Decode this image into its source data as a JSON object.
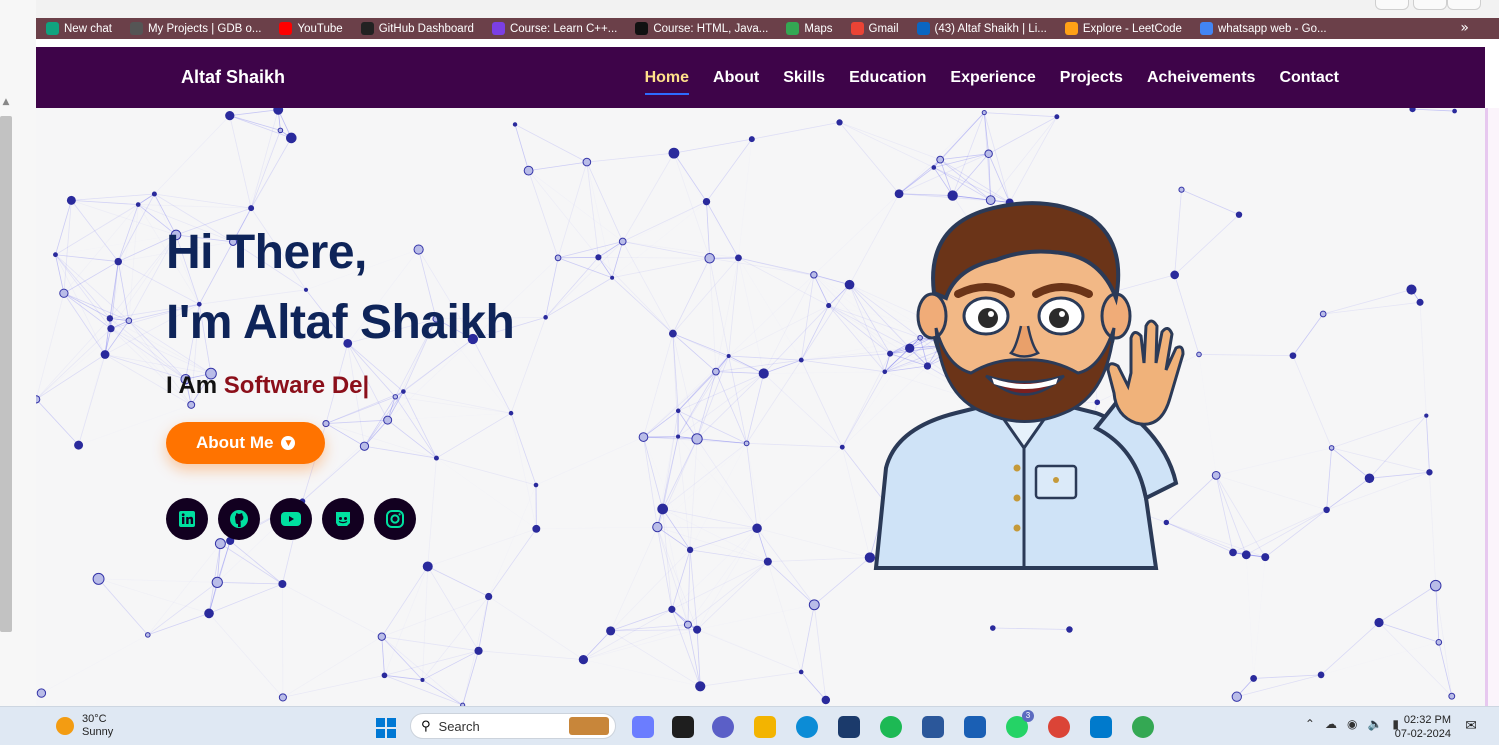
{
  "bookmarks": [
    {
      "label": "New chat",
      "color": "#10a37f"
    },
    {
      "label": "My Projects | GDB o...",
      "color": "#555555"
    },
    {
      "label": "YouTube",
      "color": "#ff0000"
    },
    {
      "label": "GitHub Dashboard",
      "color": "#222222"
    },
    {
      "label": "Course: Learn C++...",
      "color": "#7b3fe4"
    },
    {
      "label": "Course: HTML, Java...",
      "color": "#111111"
    },
    {
      "label": "Maps",
      "color": "#34a853"
    },
    {
      "label": "Gmail",
      "color": "#ea4335"
    },
    {
      "label": "(43) Altaf Shaikh | Li...",
      "color": "#0a66c2"
    },
    {
      "label": "Explore - LeetCode",
      "color": "#ffa116"
    },
    {
      "label": "whatsapp web - Go...",
      "color": "#4285f4"
    }
  ],
  "bookmarks_more": "»",
  "nav": {
    "brand": "Altaf Shaikh",
    "links": [
      "Home",
      "About",
      "Skills",
      "Education",
      "Experience",
      "Projects",
      "Acheivements",
      "Contact"
    ],
    "active_index": 0
  },
  "hero": {
    "greeting_line1": "Hi There,",
    "greeting_line2": "I'm Altaf Shaikh",
    "typing_prefix": "I Am ",
    "typing_role": "Software De|",
    "about_button": "About Me",
    "socials": [
      "linkedin-icon",
      "github-icon",
      "youtube-icon",
      "discord-icon",
      "instagram-icon"
    ]
  },
  "taskbar": {
    "temperature": "30°C",
    "condition": "Sunny",
    "search_placeholder": "Search",
    "time": "02:32 PM",
    "date": "07-02-2024",
    "whatsapp_badge": "3"
  },
  "colors": {
    "navbar": "#3e0449",
    "heading": "#0e2459",
    "accent_button": "#ff7300",
    "role_text": "#8b0f1a",
    "network_line": "#6b6bf0",
    "network_node": "#2a2a9c"
  }
}
